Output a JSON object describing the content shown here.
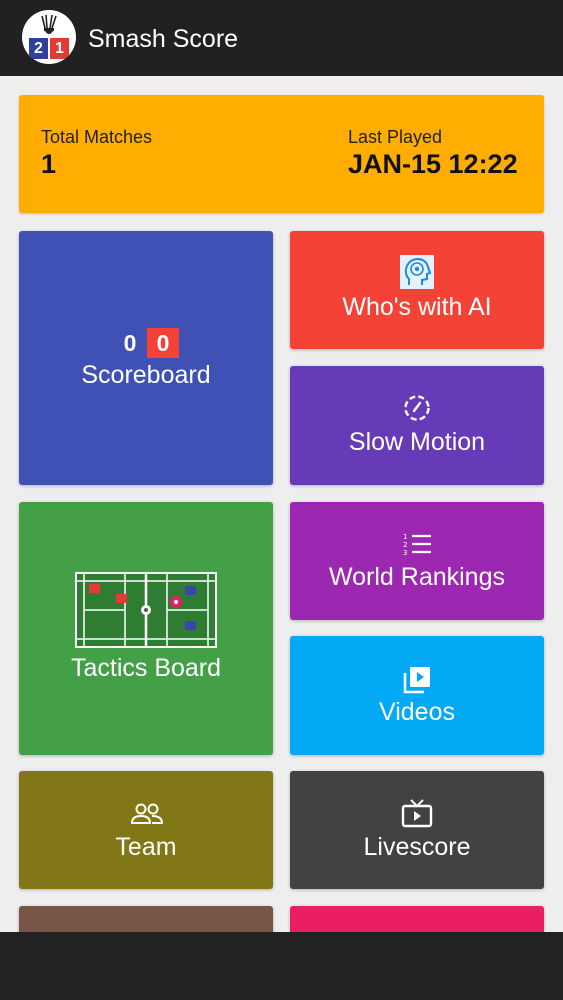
{
  "app": {
    "title": "Smash Score",
    "logo": {
      "digit_left": "2",
      "digit_right": "1",
      "left_color": "#2e3f9e",
      "right_color": "#e53935"
    }
  },
  "summary": {
    "total_matches_label": "Total Matches",
    "total_matches_value": "1",
    "last_played_label": "Last Played",
    "last_played_value": "JAN-15 12:22",
    "color": "#ffad00"
  },
  "tiles": {
    "scoreboard": {
      "label": "Scoreboard",
      "score_left": "0",
      "score_right": "0",
      "color": "#3f51b5"
    },
    "ai": {
      "label": "Who's with AI",
      "icon": "ai-head-icon",
      "color": "#f44336"
    },
    "slow_motion": {
      "label": "Slow Motion",
      "icon": "slow-motion-icon",
      "color": "#673ab7"
    },
    "tactics": {
      "label": "Tactics Board",
      "icon": "badminton-court-icon",
      "color": "#43a047"
    },
    "rankings": {
      "label": "World Rankings",
      "icon": "numbered-list-icon",
      "color": "#9c27b0"
    },
    "videos": {
      "label": "Videos",
      "icon": "video-library-icon",
      "color": "#03a9f4"
    },
    "team": {
      "label": "Team",
      "icon": "people-icon",
      "color": "#827717"
    },
    "livescore": {
      "label": "Livescore",
      "icon": "live-tv-icon",
      "color": "#424242"
    },
    "partial_left": {
      "color": "#795548"
    },
    "partial_right": {
      "color": "#e91e63"
    }
  }
}
